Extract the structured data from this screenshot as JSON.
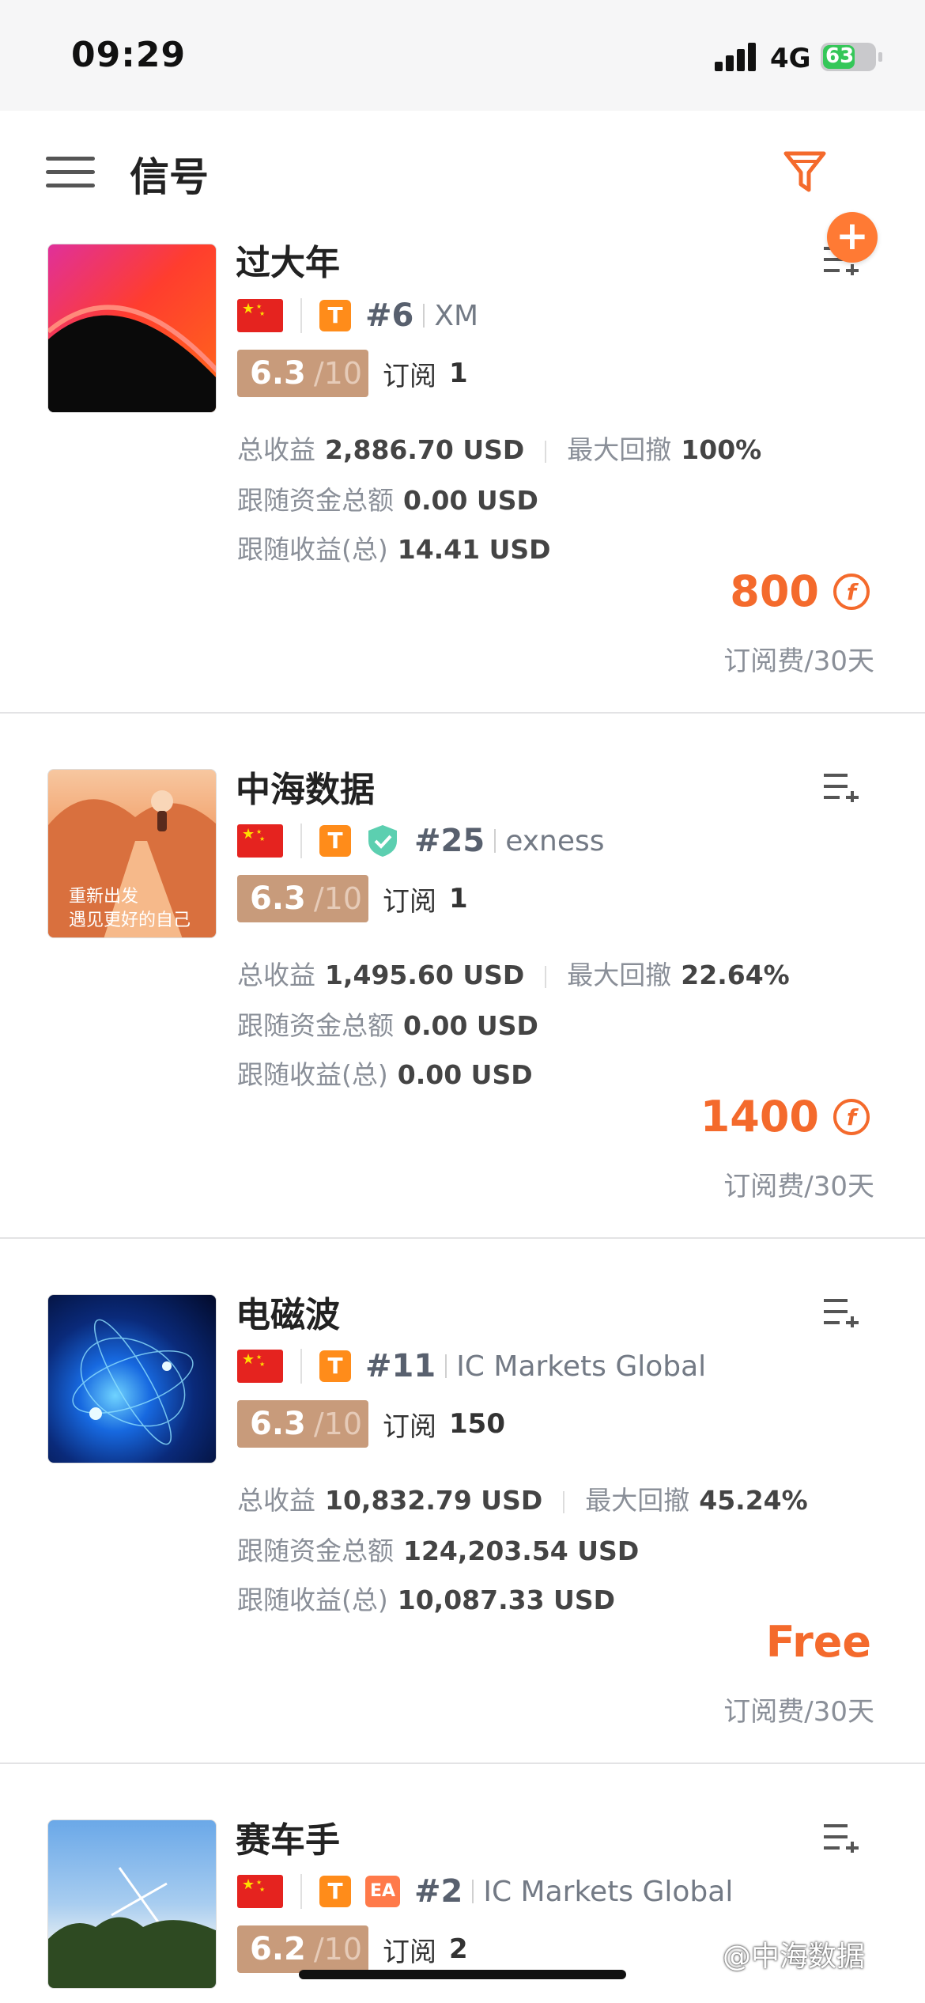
{
  "status": {
    "time": "09:29",
    "network": "4G",
    "battery": "63"
  },
  "header": {
    "title": "信号"
  },
  "signals": [
    {
      "name": "过大年",
      "rank": "#6",
      "broker": "XM",
      "verified": false,
      "ea": false,
      "score": "6.3",
      "score_max": "/10",
      "subs_label": "订阅",
      "subs": "1",
      "profit_label": "总收益",
      "profit": "2,886.70 USD",
      "drawdown_label": "最大回撤",
      "drawdown": "100%",
      "follow_funds_label": "跟随资金总额",
      "follow_funds": "0.00 USD",
      "follow_profit_label": "跟随收益(总)",
      "follow_profit": "14.41 USD",
      "price": "800",
      "price_unit": "订阅费/30天"
    },
    {
      "name": "中海数据",
      "rank": "#25",
      "broker": "exness",
      "verified": true,
      "ea": false,
      "thumb_caption_1": "重新出发",
      "thumb_caption_2": "遇见更好的自己",
      "score": "6.3",
      "score_max": "/10",
      "subs_label": "订阅",
      "subs": "1",
      "profit_label": "总收益",
      "profit": "1,495.60 USD",
      "drawdown_label": "最大回撤",
      "drawdown": "22.64%",
      "follow_funds_label": "跟随资金总额",
      "follow_funds": "0.00 USD",
      "follow_profit_label": "跟随收益(总)",
      "follow_profit": "0.00 USD",
      "price": "1400",
      "price_unit": "订阅费/30天"
    },
    {
      "name": "电磁波",
      "rank": "#11",
      "broker": "IC Markets Global",
      "verified": false,
      "ea": false,
      "score": "6.3",
      "score_max": "/10",
      "subs_label": "订阅",
      "subs": "150",
      "profit_label": "总收益",
      "profit": "10,832.79 USD",
      "drawdown_label": "最大回撤",
      "drawdown": "45.24%",
      "follow_funds_label": "跟随资金总额",
      "follow_funds": "124,203.54 USD",
      "follow_profit_label": "跟随收益(总)",
      "follow_profit": "10,087.33 USD",
      "price": "Free",
      "price_unit": "订阅费/30天"
    },
    {
      "name": "赛车手",
      "rank": "#2",
      "broker": "IC Markets Global",
      "verified": false,
      "ea": true,
      "ea_label": "EA",
      "score": "6.2",
      "score_max": "/10",
      "subs_label": "订阅",
      "subs": "2"
    }
  ],
  "badge_t": "T",
  "watermark": "@中海数据",
  "colors": {
    "accent": "#f46a2c",
    "score_bg": "#c89b7b",
    "t_badge": "#ff8c1a"
  }
}
